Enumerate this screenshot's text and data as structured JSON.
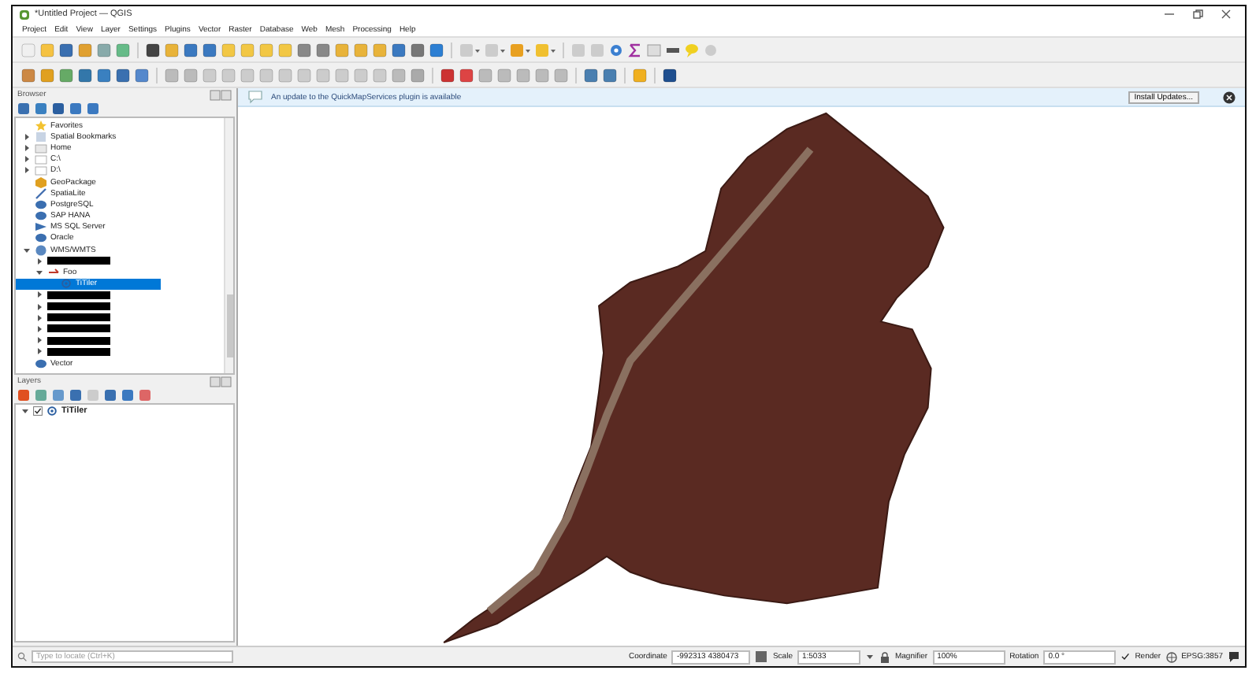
{
  "window": {
    "title": "*Untitled Project — QGIS"
  },
  "menu": [
    "Project",
    "Edit",
    "View",
    "Layer",
    "Settings",
    "Plugins",
    "Vector",
    "Raster",
    "Database",
    "Web",
    "Mesh",
    "Processing",
    "Help"
  ],
  "browser": {
    "title": "Browser",
    "items": [
      {
        "label": "Favorites",
        "kind": "star",
        "selected": false
      },
      {
        "label": "Spatial Bookmarks",
        "kind": "bookmark",
        "selected": false,
        "expanded": false
      },
      {
        "label": "Home",
        "kind": "folder",
        "selected": false,
        "expanded": false
      },
      {
        "label": "C:\\",
        "kind": "drive",
        "selected": false,
        "expanded": false
      },
      {
        "label": "D:\\",
        "kind": "drive",
        "selected": false,
        "expanded": false
      },
      {
        "label": "GeoPackage",
        "kind": "geopackage",
        "selected": false
      },
      {
        "label": "SpatiaLite",
        "kind": "spatialite",
        "selected": false
      },
      {
        "label": "PostgreSQL",
        "kind": "database",
        "selected": false
      },
      {
        "label": "SAP HANA",
        "kind": "database",
        "selected": false
      },
      {
        "label": "MS SQL Server",
        "kind": "mssql",
        "selected": false
      },
      {
        "label": "Oracle",
        "kind": "database",
        "selected": false
      },
      {
        "label": "WMS/WMTS",
        "kind": "globe",
        "selected": false,
        "expanded": true,
        "children": [
          {
            "kind": "redacted",
            "selected": false,
            "expanded": false
          },
          {
            "label": "Foo",
            "kind": "connection",
            "selected": false,
            "expanded": true,
            "children": [
              {
                "label": "TiTiler",
                "kind": "layer",
                "selected": true
              }
            ]
          },
          {
            "kind": "redacted",
            "selected": false,
            "expanded": false
          },
          {
            "kind": "redacted",
            "selected": false,
            "expanded": false
          },
          {
            "kind": "redacted",
            "selected": false,
            "expanded": false
          },
          {
            "kind": "redacted",
            "selected": false,
            "expanded": false
          },
          {
            "kind": "redacted",
            "selected": false,
            "expanded": false
          },
          {
            "kind": "redacted",
            "selected": false,
            "expanded": false
          }
        ]
      },
      {
        "label": "Vector",
        "kind": "database",
        "selected": false
      }
    ]
  },
  "layers": {
    "title": "Layers",
    "items": [
      {
        "label": "TiTiler",
        "checked": true,
        "expanded": true
      }
    ]
  },
  "message_bar": {
    "text": "An update to the QuickMapServices plugin is available",
    "button": "Install Updates..."
  },
  "status_bar": {
    "search_placeholder": "Type to locate (Ctrl+K)",
    "coordinate_label": "Coordinate",
    "coordinate": "-992313 4380473",
    "scale_label": "Scale",
    "scale": "1:5033",
    "magnifier_label": "Magnifier",
    "magnifier": "100%",
    "rotation_label": "Rotation",
    "rotation": "0.0 °",
    "render_label": "Render",
    "render": true,
    "crs": "EPSG:3857"
  }
}
